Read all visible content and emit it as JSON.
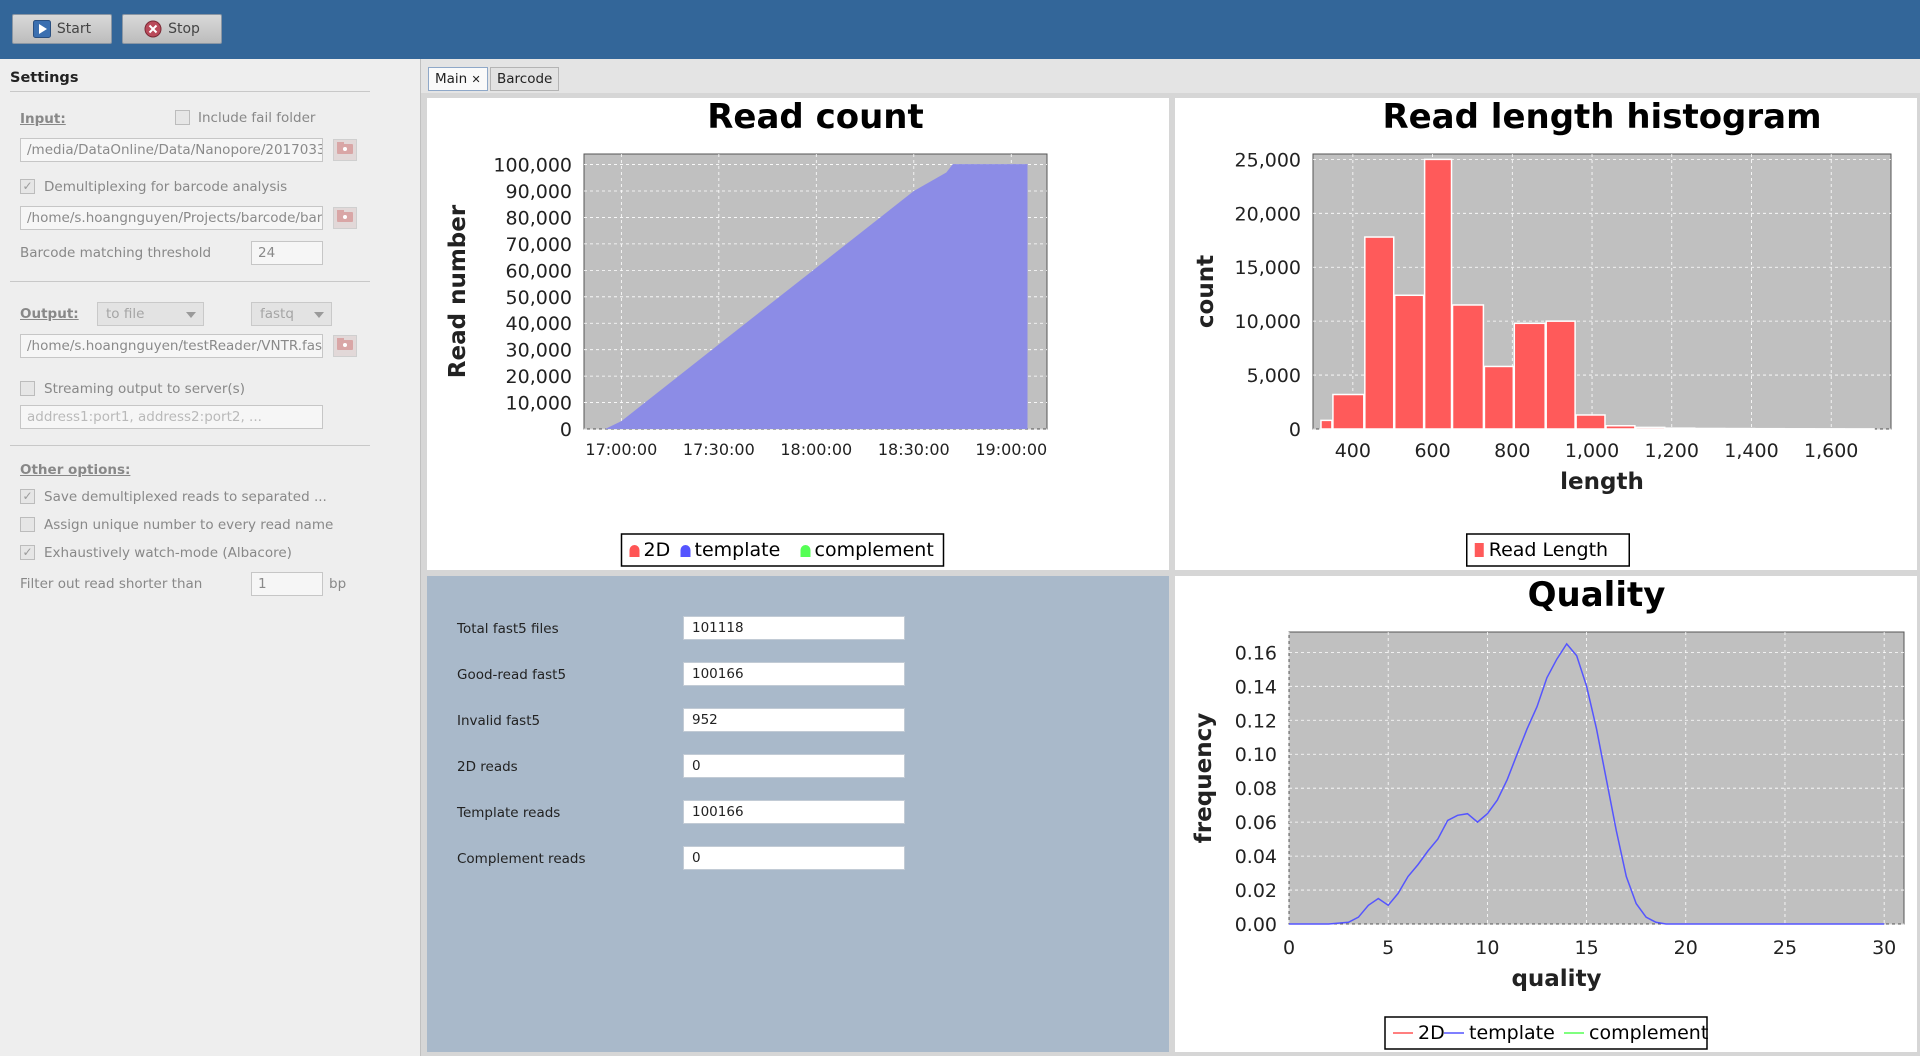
{
  "toolbar": {
    "start_label": "Start",
    "stop_label": "Stop"
  },
  "settings": {
    "title": "Settings",
    "input_label": "Input:",
    "include_fail_label": "Include fail folder",
    "include_fail_checked": false,
    "input_path": "/media/DataOnline/Data/Nanopore/2017033",
    "demux_label": "Demultiplexing for barcode analysis",
    "demux_checked": true,
    "barcode_path": "/home/s.hoangnguyen/Projects/barcode/bar",
    "threshold_label": "Barcode matching threshold",
    "threshold_value": "24",
    "output_label": "Output:",
    "output_mode": "to file",
    "output_format": "fastq",
    "output_path": "/home/s.hoangnguyen/testReader/VNTR.fas",
    "streaming_label": "Streaming output to server(s)",
    "streaming_checked": false,
    "server_placeholder": "address1:port1, address2:port2, ...",
    "other_label": "Other options:",
    "opt1_label": "Save demultiplexed reads to separated ...",
    "opt1_checked": true,
    "opt2_label": "Assign unique number to every read name",
    "opt2_checked": false,
    "opt3_label": "Exhaustively watch-mode (Albacore)",
    "opt3_checked": true,
    "filter_label": "Filter out read shorter than",
    "filter_value": "1",
    "filter_unit": "bp"
  },
  "tabs": {
    "main": "Main",
    "close_glyph": "✕",
    "barcode": "Barcode"
  },
  "stats": {
    "total_label": "Total fast5 files",
    "total_value": "101118",
    "good_label": "Good-read fast5",
    "good_value": "100166",
    "invalid_label": "Invalid fast5",
    "invalid_value": "952",
    "twod_label": "2D reads",
    "twod_value": "0",
    "template_label": "Template reads",
    "template_value": "100166",
    "complement_label": "Complement reads",
    "complement_value": "0"
  },
  "colors": {
    "twod": "#ff5555",
    "template": "#5555ff",
    "complement": "#55ff55",
    "plot_bg": "#c0c0c0",
    "fill": "#8c8ce6"
  },
  "chart_data": [
    {
      "type": "area",
      "title": "Read count",
      "xlabel": "",
      "ylabel": "Read number",
      "x_ticks": [
        "17:00:00",
        "17:30:00",
        "18:00:00",
        "18:30:00",
        "19:00:00"
      ],
      "y_ticks": [
        "0",
        "10,000",
        "20,000",
        "30,000",
        "40,000",
        "50,000",
        "60,000",
        "70,000",
        "80,000",
        "90,000",
        "100,000"
      ],
      "ylim": [
        0,
        104000
      ],
      "xlim": [
        "16:48:30",
        "19:11:00"
      ],
      "series": [
        {
          "name": "template",
          "points": [
            [
              "16:55:00",
              0
            ],
            [
              "17:00:00",
              3000
            ],
            [
              "17:30:00",
              32000
            ],
            [
              "18:00:00",
              61000
            ],
            [
              "18:30:00",
              90000
            ],
            [
              "18:40:00",
              97000
            ],
            [
              "18:42:00",
              100166
            ],
            [
              "19:05:00",
              100166
            ],
            [
              "19:05:00",
              0
            ]
          ]
        }
      ],
      "legend": [
        "2D",
        "template",
        "complement"
      ],
      "legend_position": "bottom",
      "grid": true
    },
    {
      "type": "bar",
      "title": "Read length histogram",
      "xlabel": "length",
      "ylabel": "count",
      "x_ticks": [
        "400",
        "600",
        "800",
        "1,000",
        "1,200",
        "1,400",
        "1,600"
      ],
      "y_ticks": [
        "0",
        "5,000",
        "10,000",
        "15,000",
        "20,000",
        "25,000"
      ],
      "xlim": [
        300,
        1750
      ],
      "ylim": [
        0,
        25500
      ],
      "bins": [
        [
          320,
          350,
          800
        ],
        [
          350,
          430,
          3200
        ],
        [
          430,
          505,
          17800
        ],
        [
          505,
          580,
          12400
        ],
        [
          580,
          650,
          25000
        ],
        [
          650,
          730,
          11500
        ],
        [
          730,
          805,
          5800
        ],
        [
          805,
          885,
          9800
        ],
        [
          885,
          960,
          10000
        ],
        [
          960,
          1035,
          1300
        ],
        [
          1035,
          1110,
          300
        ],
        [
          1110,
          1185,
          150
        ],
        [
          1185,
          1260,
          80
        ],
        [
          1260,
          1335,
          50
        ],
        [
          1335,
          1410,
          40
        ],
        [
          1410,
          1485,
          30
        ],
        [
          1485,
          1560,
          20
        ],
        [
          1560,
          1635,
          15
        ],
        [
          1635,
          1710,
          10
        ]
      ],
      "legend": [
        "Read Length"
      ],
      "legend_position": "bottom",
      "grid": true
    },
    {
      "type": "line",
      "title": "Quality",
      "xlabel": "quality",
      "ylabel": "frequency",
      "x_ticks": [
        "0",
        "5",
        "10",
        "15",
        "20",
        "25",
        "30"
      ],
      "y_ticks": [
        "0.00",
        "0.02",
        "0.04",
        "0.06",
        "0.08",
        "0.10",
        "0.12",
        "0.14",
        "0.16"
      ],
      "xlim": [
        0,
        31
      ],
      "ylim": [
        0,
        0.172
      ],
      "series": [
        {
          "name": "template",
          "x": [
            0,
            2,
            3,
            3.5,
            4,
            4.5,
            5,
            5.5,
            6,
            6.5,
            7,
            7.5,
            8,
            8.5,
            9,
            9.5,
            10,
            10.5,
            11,
            11.5,
            12,
            12.5,
            13,
            13.5,
            14,
            14.5,
            15,
            15.5,
            16,
            16.5,
            17,
            17.5,
            18,
            18.5,
            19,
            20,
            25,
            30
          ],
          "y": [
            0,
            0,
            0.001,
            0.004,
            0.011,
            0.015,
            0.011,
            0.018,
            0.028,
            0.035,
            0.043,
            0.05,
            0.061,
            0.064,
            0.065,
            0.06,
            0.065,
            0.073,
            0.085,
            0.1,
            0.115,
            0.128,
            0.145,
            0.156,
            0.165,
            0.158,
            0.14,
            0.115,
            0.085,
            0.055,
            0.028,
            0.012,
            0.004,
            0.001,
            0,
            0,
            0,
            0
          ]
        }
      ],
      "legend": [
        "2D",
        "template",
        "complement"
      ],
      "legend_position": "bottom",
      "grid": true
    }
  ]
}
